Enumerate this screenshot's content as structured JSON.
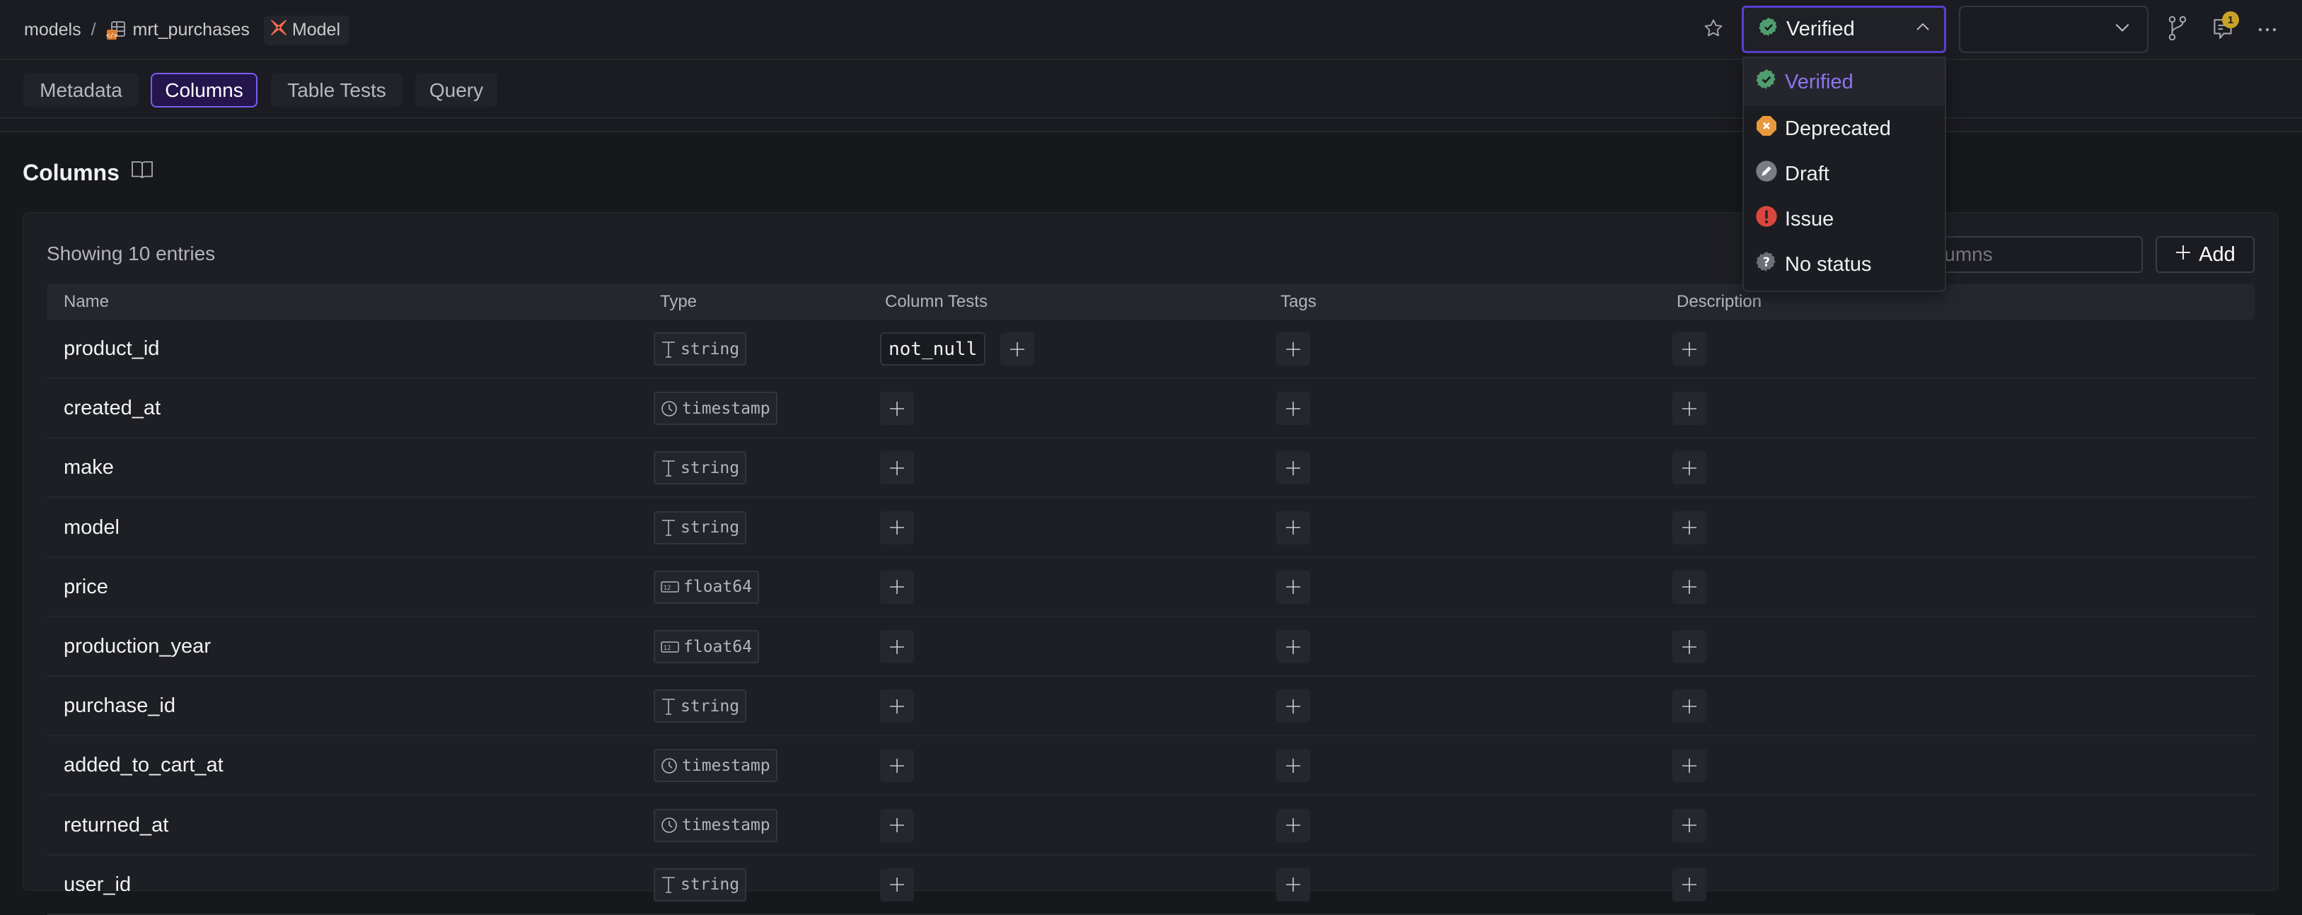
{
  "breadcrumb": {
    "root": "models",
    "separator": "/",
    "model_name": "mrt_purchases",
    "badge_label": "Model"
  },
  "toolbar": {
    "star_icon": "star-icon",
    "status_select": {
      "value": "Verified",
      "icon": "verified-badge-icon",
      "expanded": true
    },
    "branch_select": {
      "value": ""
    },
    "notifications_count": "1"
  },
  "tabs": [
    {
      "label": "Metadata",
      "active": false
    },
    {
      "label": "Columns",
      "active": true
    },
    {
      "label": "Table Tests",
      "active": false
    },
    {
      "label": "Query",
      "active": false
    }
  ],
  "section": {
    "title": "Columns",
    "entries_text": "Showing 10 entries",
    "search_placeholder": "Search columns",
    "add_label": "Add"
  },
  "table": {
    "headers": [
      "Name",
      "Type",
      "Column Tests",
      "Tags",
      "Description"
    ],
    "rows": [
      {
        "name": "product_id",
        "type": "string",
        "type_icon": "text-type-icon",
        "tests": [
          "not_null"
        ]
      },
      {
        "name": "created_at",
        "type": "timestamp",
        "type_icon": "clock-icon",
        "tests": []
      },
      {
        "name": "make",
        "type": "string",
        "type_icon": "text-type-icon",
        "tests": []
      },
      {
        "name": "model",
        "type": "string",
        "type_icon": "text-type-icon",
        "tests": []
      },
      {
        "name": "price",
        "type": "float64",
        "type_icon": "number-icon",
        "tests": []
      },
      {
        "name": "production_year",
        "type": "float64",
        "type_icon": "number-icon",
        "tests": []
      },
      {
        "name": "purchase_id",
        "type": "string",
        "type_icon": "text-type-icon",
        "tests": []
      },
      {
        "name": "added_to_cart_at",
        "type": "timestamp",
        "type_icon": "clock-icon",
        "tests": []
      },
      {
        "name": "returned_at",
        "type": "timestamp",
        "type_icon": "clock-icon",
        "tests": []
      },
      {
        "name": "user_id",
        "type": "string",
        "type_icon": "text-type-icon",
        "tests": []
      }
    ]
  },
  "status_menu": {
    "items": [
      {
        "label": "Verified",
        "icon": "verified-icon",
        "color": "#4f9d6f",
        "selected": true
      },
      {
        "label": "Deprecated",
        "icon": "deprecated-icon",
        "color": "#e8993b",
        "selected": false
      },
      {
        "label": "Draft",
        "icon": "draft-icon",
        "color": "#7a7c86",
        "selected": false
      },
      {
        "label": "Issue",
        "icon": "issue-icon",
        "color": "#d9473e",
        "selected": false
      },
      {
        "label": "No status",
        "icon": "no-status-icon",
        "color": "#6c6e78",
        "selected": false
      }
    ]
  },
  "colors": {
    "accent": "#7a5cf0",
    "dbt_orange": "#ff694b",
    "notification_badge": "#c9a227"
  }
}
